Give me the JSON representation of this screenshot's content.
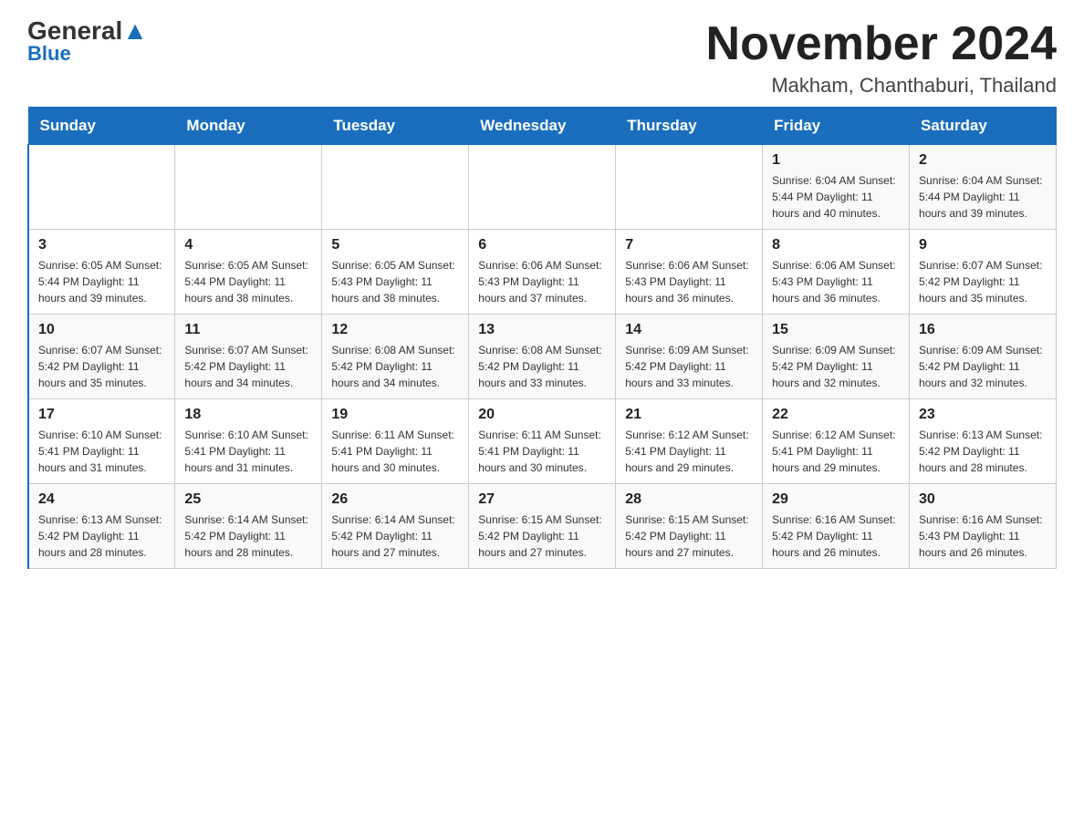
{
  "logo": {
    "general": "General",
    "blue": "Blue"
  },
  "header": {
    "month_year": "November 2024",
    "location": "Makham, Chanthaburi, Thailand"
  },
  "days_of_week": [
    "Sunday",
    "Monday",
    "Tuesday",
    "Wednesday",
    "Thursday",
    "Friday",
    "Saturday"
  ],
  "weeks": [
    {
      "days": [
        {
          "number": "",
          "info": ""
        },
        {
          "number": "",
          "info": ""
        },
        {
          "number": "",
          "info": ""
        },
        {
          "number": "",
          "info": ""
        },
        {
          "number": "",
          "info": ""
        },
        {
          "number": "1",
          "info": "Sunrise: 6:04 AM\nSunset: 5:44 PM\nDaylight: 11 hours and 40 minutes."
        },
        {
          "number": "2",
          "info": "Sunrise: 6:04 AM\nSunset: 5:44 PM\nDaylight: 11 hours and 39 minutes."
        }
      ]
    },
    {
      "days": [
        {
          "number": "3",
          "info": "Sunrise: 6:05 AM\nSunset: 5:44 PM\nDaylight: 11 hours and 39 minutes."
        },
        {
          "number": "4",
          "info": "Sunrise: 6:05 AM\nSunset: 5:44 PM\nDaylight: 11 hours and 38 minutes."
        },
        {
          "number": "5",
          "info": "Sunrise: 6:05 AM\nSunset: 5:43 PM\nDaylight: 11 hours and 38 minutes."
        },
        {
          "number": "6",
          "info": "Sunrise: 6:06 AM\nSunset: 5:43 PM\nDaylight: 11 hours and 37 minutes."
        },
        {
          "number": "7",
          "info": "Sunrise: 6:06 AM\nSunset: 5:43 PM\nDaylight: 11 hours and 36 minutes."
        },
        {
          "number": "8",
          "info": "Sunrise: 6:06 AM\nSunset: 5:43 PM\nDaylight: 11 hours and 36 minutes."
        },
        {
          "number": "9",
          "info": "Sunrise: 6:07 AM\nSunset: 5:42 PM\nDaylight: 11 hours and 35 minutes."
        }
      ]
    },
    {
      "days": [
        {
          "number": "10",
          "info": "Sunrise: 6:07 AM\nSunset: 5:42 PM\nDaylight: 11 hours and 35 minutes."
        },
        {
          "number": "11",
          "info": "Sunrise: 6:07 AM\nSunset: 5:42 PM\nDaylight: 11 hours and 34 minutes."
        },
        {
          "number": "12",
          "info": "Sunrise: 6:08 AM\nSunset: 5:42 PM\nDaylight: 11 hours and 34 minutes."
        },
        {
          "number": "13",
          "info": "Sunrise: 6:08 AM\nSunset: 5:42 PM\nDaylight: 11 hours and 33 minutes."
        },
        {
          "number": "14",
          "info": "Sunrise: 6:09 AM\nSunset: 5:42 PM\nDaylight: 11 hours and 33 minutes."
        },
        {
          "number": "15",
          "info": "Sunrise: 6:09 AM\nSunset: 5:42 PM\nDaylight: 11 hours and 32 minutes."
        },
        {
          "number": "16",
          "info": "Sunrise: 6:09 AM\nSunset: 5:42 PM\nDaylight: 11 hours and 32 minutes."
        }
      ]
    },
    {
      "days": [
        {
          "number": "17",
          "info": "Sunrise: 6:10 AM\nSunset: 5:41 PM\nDaylight: 11 hours and 31 minutes."
        },
        {
          "number": "18",
          "info": "Sunrise: 6:10 AM\nSunset: 5:41 PM\nDaylight: 11 hours and 31 minutes."
        },
        {
          "number": "19",
          "info": "Sunrise: 6:11 AM\nSunset: 5:41 PM\nDaylight: 11 hours and 30 minutes."
        },
        {
          "number": "20",
          "info": "Sunrise: 6:11 AM\nSunset: 5:41 PM\nDaylight: 11 hours and 30 minutes."
        },
        {
          "number": "21",
          "info": "Sunrise: 6:12 AM\nSunset: 5:41 PM\nDaylight: 11 hours and 29 minutes."
        },
        {
          "number": "22",
          "info": "Sunrise: 6:12 AM\nSunset: 5:41 PM\nDaylight: 11 hours and 29 minutes."
        },
        {
          "number": "23",
          "info": "Sunrise: 6:13 AM\nSunset: 5:42 PM\nDaylight: 11 hours and 28 minutes."
        }
      ]
    },
    {
      "days": [
        {
          "number": "24",
          "info": "Sunrise: 6:13 AM\nSunset: 5:42 PM\nDaylight: 11 hours and 28 minutes."
        },
        {
          "number": "25",
          "info": "Sunrise: 6:14 AM\nSunset: 5:42 PM\nDaylight: 11 hours and 28 minutes."
        },
        {
          "number": "26",
          "info": "Sunrise: 6:14 AM\nSunset: 5:42 PM\nDaylight: 11 hours and 27 minutes."
        },
        {
          "number": "27",
          "info": "Sunrise: 6:15 AM\nSunset: 5:42 PM\nDaylight: 11 hours and 27 minutes."
        },
        {
          "number": "28",
          "info": "Sunrise: 6:15 AM\nSunset: 5:42 PM\nDaylight: 11 hours and 27 minutes."
        },
        {
          "number": "29",
          "info": "Sunrise: 6:16 AM\nSunset: 5:42 PM\nDaylight: 11 hours and 26 minutes."
        },
        {
          "number": "30",
          "info": "Sunrise: 6:16 AM\nSunset: 5:43 PM\nDaylight: 11 hours and 26 minutes."
        }
      ]
    }
  ]
}
